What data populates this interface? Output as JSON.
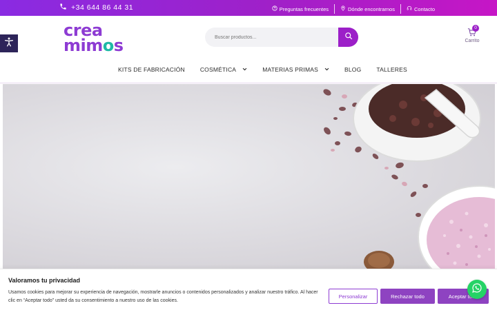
{
  "topbar": {
    "phone": "+34 644 86 44 31",
    "links": [
      "Preguntas frecuentes",
      "Dónde encontrarnos",
      "Contacto"
    ],
    "icons": [
      "phone-icon",
      "question-circle-icon",
      "map-pin-icon",
      "headset-icon"
    ]
  },
  "header": {
    "logo": {
      "line1": "crea",
      "line2_a": "mim",
      "line2_o": "o",
      "line2_b": "s"
    },
    "search": {
      "placeholder": "Buscar productos..."
    },
    "cart": {
      "count": "0",
      "label": "Carrito"
    }
  },
  "nav": {
    "items": [
      {
        "label": "KITS DE FABRICACIÓN",
        "has_dropdown": false
      },
      {
        "label": "COSMÉTICA",
        "has_dropdown": true
      },
      {
        "label": "MATERIAS PRIMAS",
        "has_dropdown": true
      },
      {
        "label": "BLOG",
        "has_dropdown": false
      },
      {
        "label": "TALLERES",
        "has_dropdown": false
      }
    ]
  },
  "cookie": {
    "title": "Valoramos tu privacidad",
    "text": "Usamos cookies para mejorar su experiencia de navegación, mostrarle anuncios o contenidos personalizados y analizar nuestro tráfico. Al hacer clic en “Aceptar todo” usted da su consentimiento a nuestro uso de las cookies.",
    "buttons": {
      "customize": "Personalizar",
      "reject": "Rechazar todo",
      "accept": "Aceptar todo"
    }
  },
  "colors": {
    "brand_purple": "#8d3bd3",
    "accent_teal": "#1fb9a6",
    "topbar_gradient_start": "#8a2be2",
    "topbar_gradient_end": "#c616c6",
    "whatsapp_green": "#25d366"
  }
}
